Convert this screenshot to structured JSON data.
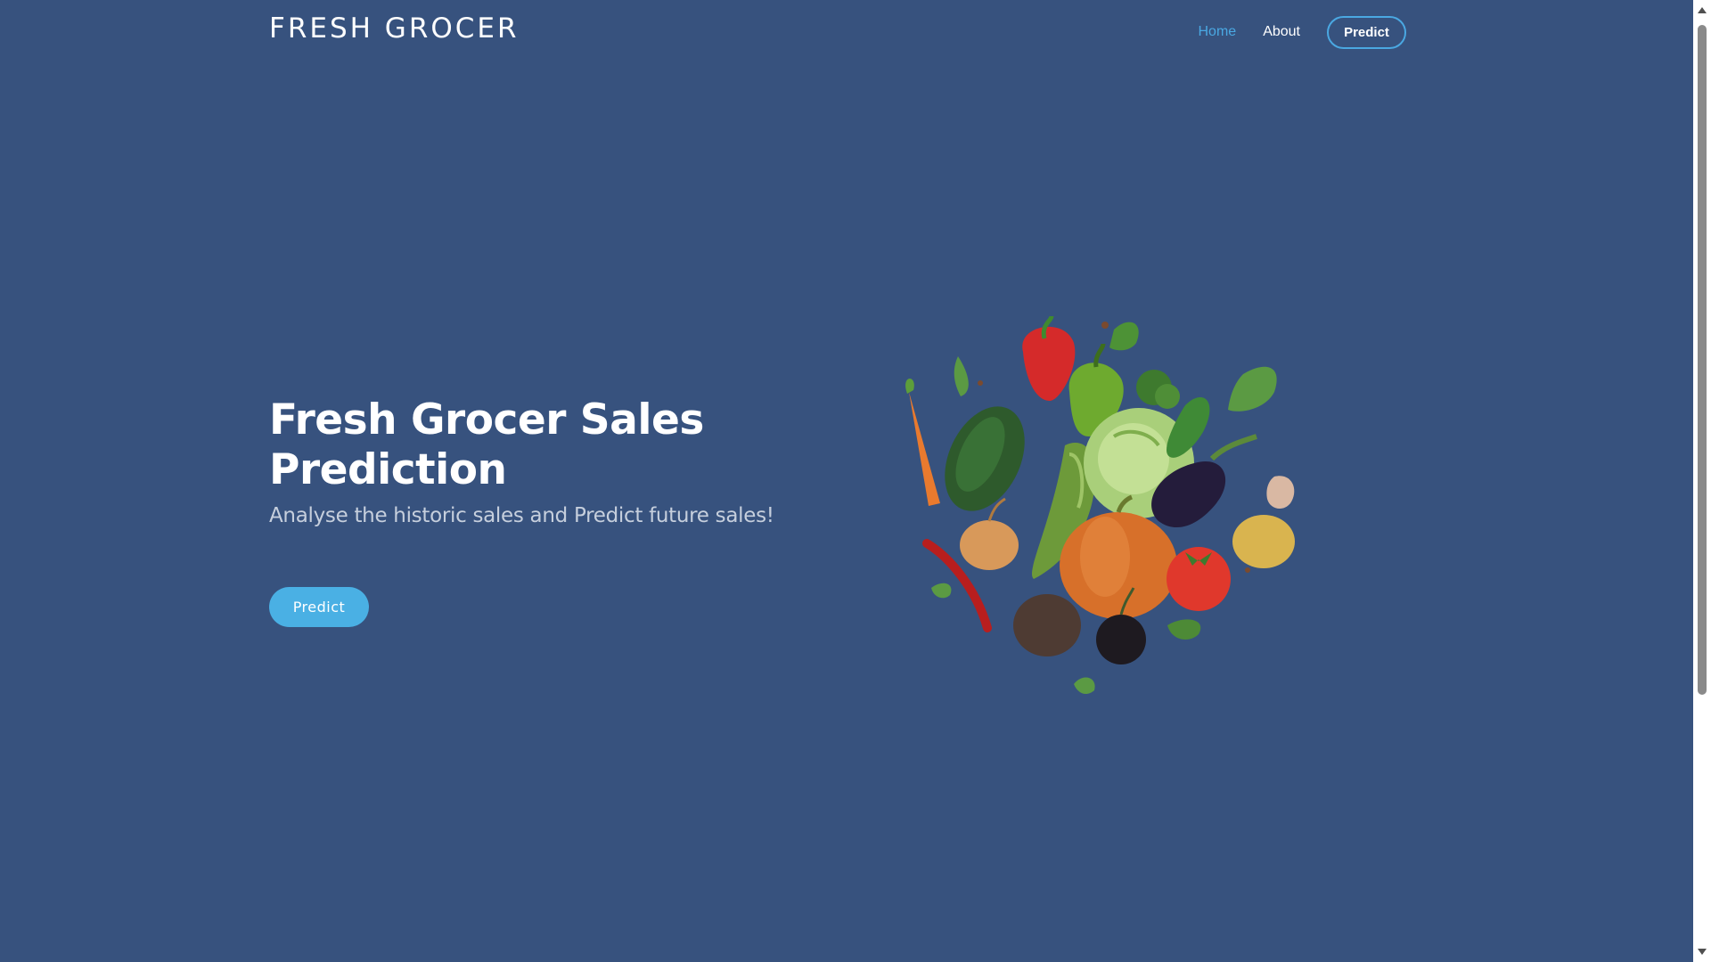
{
  "brand": {
    "logo": "FRESH GROCER"
  },
  "nav": {
    "home": "Home",
    "about": "About",
    "predict": "Predict"
  },
  "hero": {
    "title": "Fresh Grocer Sales Prediction",
    "subtitle": "Analyse the historic sales and Predict future sales!",
    "cta": "Predict"
  },
  "colors": {
    "background": "#37527e",
    "accent": "#4ab0e4",
    "nav_active": "#4aa8e2",
    "subtitle": "#c6cfdd"
  },
  "images": {
    "hero_illustration": "vegetables-icon"
  }
}
